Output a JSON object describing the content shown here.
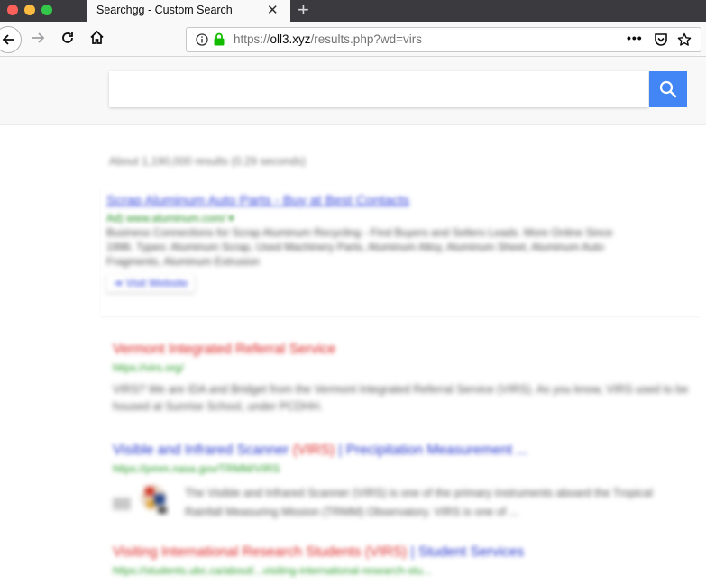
{
  "browser": {
    "tab_title": "Searchgg - Custom Search",
    "url_prefix": "https://",
    "url_host": "oll3.xyz",
    "url_path": "/results.php?wd=virs",
    "more_label": "•••"
  },
  "search": {
    "query": "",
    "placeholder": ""
  },
  "results": {
    "stats": "About 1,190,000 results (0.29 seconds)",
    "ad": {
      "title": "Scrap Aluminum Auto Parts - Buy at Best Contacts",
      "url": "Ad) www.aluminum.com/ ▾",
      "description": "Business Connections for Scrap Aluminum Recycling - Find Buyers and Sellers Leads. More Online Since 1996. Types: Aluminum Scrap, Used Machinery Parts, Aluminum Alloy, Aluminum Sheet, Aluminum Auto Fragments, Aluminum Extrusion",
      "visit_label": "➔ Visit Website"
    },
    "items": [
      {
        "title": "Vermont Integrated Referral Service",
        "url": "https://virs.org/",
        "description": "VIRS? We are IDA and Bridget from the Vermont Integrated Referral Service (VIRS). As you know, VIRS used to be housed at Sunrise School, under PCDHH."
      },
      {
        "title_a": "Visible and Infrared Scanner ",
        "title_b": "(VIRS)",
        "title_c": " | Precipitation Measurement ...",
        "url": "https://pmm.nasa.gov/TRMM/VIRS",
        "description": "The Visible and Infrared Scanner (VIRS) is one of the primary instruments aboard the Tropical Rainfall Measuring Mission (TRMM) Observatory. VIRS is one of ..."
      },
      {
        "title_a": "Visiting International Research Students ",
        "title_b": "(VIRS)",
        "title_c": " | Student Services",
        "url": "https://students.ubc.ca/about/...visiting-international-research-stu..."
      }
    ]
  }
}
